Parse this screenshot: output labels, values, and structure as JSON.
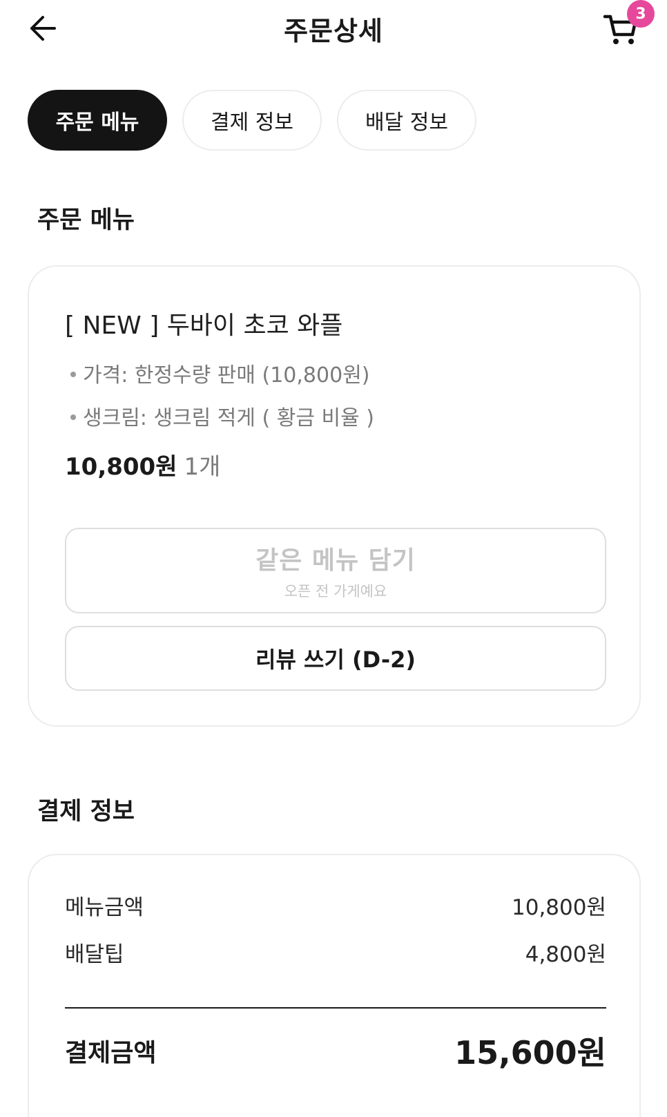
{
  "header": {
    "title": "주문상세",
    "back_icon": "arrow-left-icon",
    "cart_icon": "cart-icon",
    "cart_count": "3",
    "badge_color": "#e6489b"
  },
  "tabs": [
    {
      "label": "주문 메뉴",
      "active": true
    },
    {
      "label": "결제 정보",
      "active": false
    },
    {
      "label": "배달 정보",
      "active": false
    }
  ],
  "order_menu": {
    "section_title": "주문 메뉴",
    "item": {
      "name": "[ NEW ] 두바이 초코 와플",
      "options": [
        "가격: 한정수량 판매 (10,800원)",
        "생크림: 생크림 적게 ( 황금 비율 )"
      ],
      "price": "10,800원",
      "quantity": "1개"
    },
    "reorder_button": {
      "label": "같은 메뉴 담기",
      "sublabel": "오픈 전 가게예요",
      "disabled": true
    },
    "review_button": {
      "label": "리뷰 쓰기 (D-2)"
    }
  },
  "payment_info": {
    "section_title": "결제 정보",
    "rows": [
      {
        "label": "메뉴금액",
        "value": "10,800원"
      },
      {
        "label": "배달팁",
        "value": "4,800원"
      }
    ],
    "total_label": "결제금액",
    "total_value": "15,600원"
  }
}
